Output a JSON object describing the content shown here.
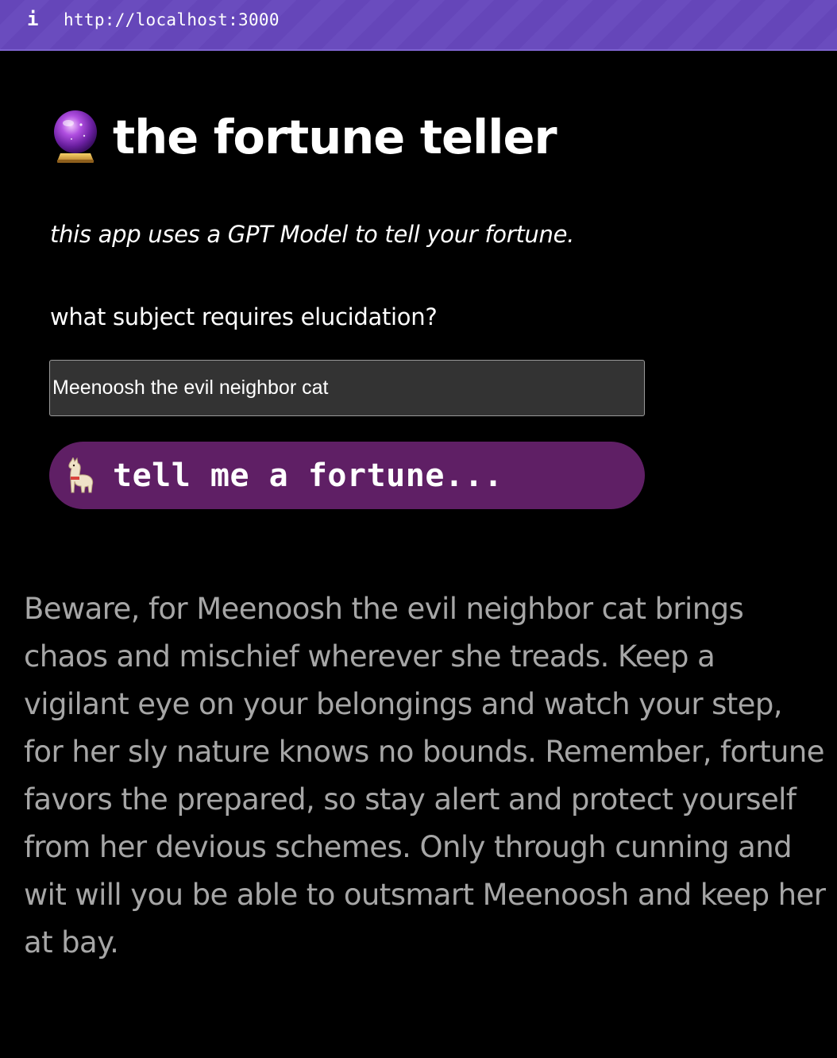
{
  "browser": {
    "url": "http://localhost:3000",
    "info_icon": "i"
  },
  "header": {
    "icon": "crystal-ball-icon",
    "title": "the fortune teller"
  },
  "subtitle": "this app uses a GPT Model to tell your fortune.",
  "form": {
    "label": "what subject requires elucidation?",
    "input_value": "Meenoosh the evil neighbor cat",
    "button_icon": "llama-icon",
    "button_label": "tell me a fortune..."
  },
  "result": {
    "text": "Beware, for Meenoosh the evil neighbor cat brings chaos and mischief wherever she treads. Keep a vigilant eye on your belongings and watch your step, for her sly nature knows no bounds. Remember, fortune favors the prepared, so stay alert and protect yourself from her devious schemes. Only through cunning and wit will you be able to outsmart Meenoosh and keep her at bay."
  },
  "colors": {
    "urlbar": "#6546b9",
    "button": "#5f1f65",
    "input_bg": "#333333",
    "result_text": "#a6a6a6"
  }
}
